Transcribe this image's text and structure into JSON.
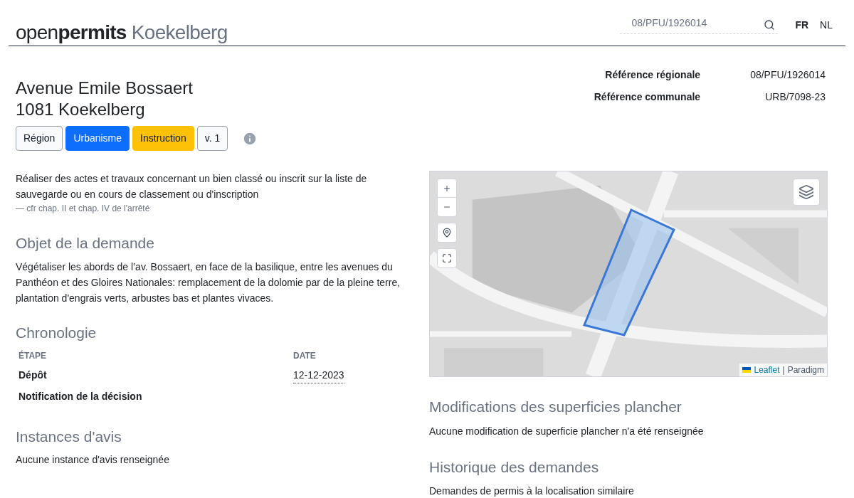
{
  "header": {
    "brand_light": "open",
    "brand_bold": "permits",
    "brand_city": "Koekelberg",
    "search": {
      "placeholder": "08/PFU/1926014"
    },
    "languages": [
      {
        "label": "FR",
        "selected": true
      },
      {
        "label": "NL",
        "selected": false
      }
    ]
  },
  "address": {
    "street": "Avenue Emile Bossaert",
    "city": "1081 Koekelberg"
  },
  "badges": [
    {
      "label": "Région",
      "kind": "outline"
    },
    {
      "label": "Urbanisme",
      "kind": "primary"
    },
    {
      "label": "Instruction",
      "kind": "warning"
    },
    {
      "label": "v. 1",
      "kind": "outline"
    }
  ],
  "references": [
    {
      "label": "Référence régionale",
      "value": "08/PFU/1926014"
    },
    {
      "label": "Référence communale",
      "value": "URB/7098-23"
    }
  ],
  "nature": {
    "text": "Réaliser des actes et travaux concernant un bien classé ou inscrit sur la liste de sauvegarde ou en cours de classement ou d'inscription",
    "note": "— cfr chap. II et chap. IV de l'arrêté"
  },
  "objet": {
    "title": "Objet de la demande",
    "text": "Végétaliser les abords de l’av. Bossaert, en face de la basilique, entre les avenues du Panthéon et des Gloires Nationales: remplacement de la dolomie par de la pleine terre, plantation d'engrais verts, arbustes bas et plantes vivaces."
  },
  "chronologie": {
    "title": "Chronologie",
    "columns": [
      "ÉTAPE",
      "DATE"
    ],
    "rows": [
      {
        "step": "Dépôt",
        "date": "12-12-2023"
      },
      {
        "step": "Notification de la décision",
        "date": ""
      }
    ]
  },
  "instances": {
    "title": "Instances d'avis",
    "text": "Aucune instance d'avis renseignée"
  },
  "map": {
    "attribution_link": "Leaflet",
    "attribution_sep": "|",
    "attribution_source": "Paradigm"
  },
  "superficies": {
    "title": "Modifications des superficies plancher",
    "text": "Aucune modification de superficie plancher n'a été renseignée"
  },
  "historique": {
    "title": "Historique des demandes",
    "text": "Demandes de permis à la localisation similaire"
  }
}
